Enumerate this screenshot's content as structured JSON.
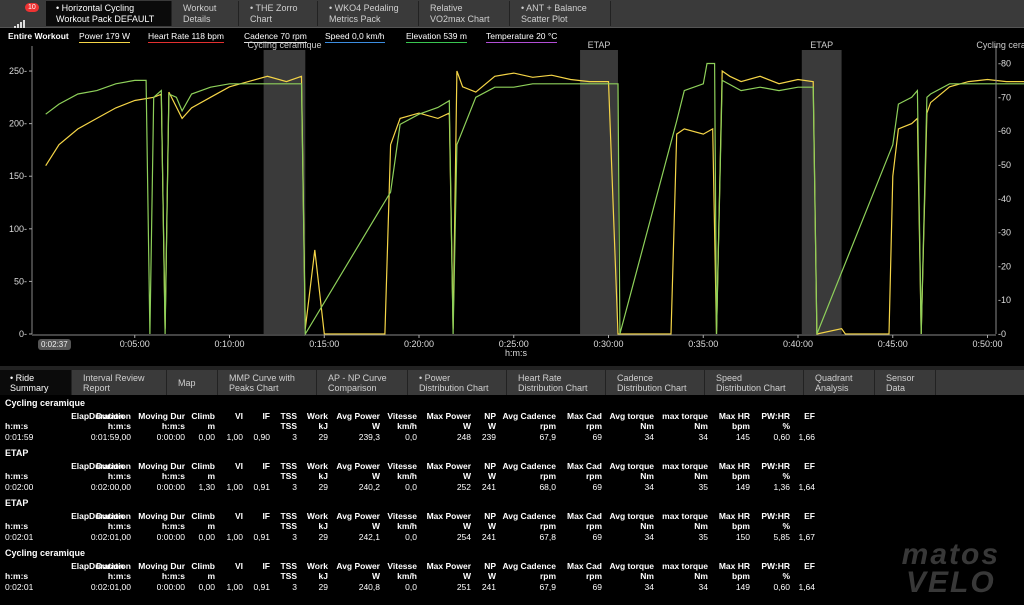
{
  "top_tabs": [
    {
      "label": "• Horizontal Cycling\nWorkout Pack DEFAULT"
    },
    {
      "label": "Workout\nDetails"
    },
    {
      "label": "• THE Zorro\nChart"
    },
    {
      "label": "• WKO4 Pedaling\nMetrics Pack"
    },
    {
      "label": "Relative\nVO2max Chart"
    },
    {
      "label": "• ANT + Balance\nScatter Plot"
    }
  ],
  "notification_badge": "10",
  "chart": {
    "scope_label": "Entire Workout",
    "legend": [
      {
        "label": "Power  179 W",
        "color": "#f5d547"
      },
      {
        "label": "Heart Rate  118 bpm",
        "color": "#e33030"
      },
      {
        "label": "Cadence  70 rpm",
        "color": "#dddddd"
      },
      {
        "label": "Speed  0,0 km/h",
        "color": "#3c8de0"
      },
      {
        "label": "Elevation  539 m",
        "color": "#39c650"
      },
      {
        "label": "Temperature  20 °C",
        "color": "#b24ed6"
      }
    ],
    "interval_labels": [
      "Cycling ceramique",
      "ETAP",
      "ETAP",
      "Cycling ceramique"
    ],
    "x_axis_label": "h:m:s",
    "current_time": "0:02:37"
  },
  "chart_data": {
    "type": "line",
    "x_ticks": [
      "0:05:00",
      "0:10:00",
      "0:15:00",
      "0:20:00",
      "0:25:00",
      "0:30:00",
      "0:35:00",
      "0:40:00",
      "0:45:00",
      "0:50:00"
    ],
    "y_left_ticks": [
      0,
      50,
      100,
      150,
      200,
      250
    ],
    "y_right_ticks": [
      0,
      10,
      20,
      30,
      40,
      50,
      60,
      70,
      80
    ],
    "xlabel": "h:m:s",
    "xlim_minutes": [
      0,
      53
    ],
    "ylim_left": [
      0,
      270
    ],
    "ylim_right": [
      0,
      84
    ],
    "intervals_minutes": [
      [
        11.8,
        14.0
      ],
      [
        28.5,
        30.5
      ],
      [
        40.2,
        42.3
      ],
      [
        52.5,
        54.6
      ]
    ],
    "series": [
      {
        "name": "Power",
        "color": "#f5d547",
        "axis": "left",
        "points": [
          [
            0.3,
            160
          ],
          [
            1,
            180
          ],
          [
            2,
            195
          ],
          [
            3,
            205
          ],
          [
            4,
            215
          ],
          [
            5,
            222
          ],
          [
            6,
            225
          ],
          [
            6.4,
            228
          ],
          [
            6.6,
            5
          ],
          [
            6.8,
            230
          ],
          [
            7.5,
            205
          ],
          [
            8,
            215
          ],
          [
            9,
            225
          ],
          [
            10,
            235
          ],
          [
            11,
            240
          ],
          [
            12,
            245
          ],
          [
            13,
            240
          ],
          [
            13.8,
            245
          ],
          [
            14,
            5
          ],
          [
            14.5,
            80
          ],
          [
            15,
            0
          ],
          [
            16,
            0
          ],
          [
            18.2,
            0
          ],
          [
            18.5,
            180
          ],
          [
            19,
            205
          ],
          [
            20,
            210
          ],
          [
            21,
            205
          ],
          [
            21.6,
            210
          ],
          [
            21.8,
            5
          ],
          [
            22,
            250
          ],
          [
            22.3,
            235
          ],
          [
            23,
            230
          ],
          [
            24,
            245
          ],
          [
            25,
            248
          ],
          [
            26,
            244
          ],
          [
            27,
            246
          ],
          [
            28,
            242
          ],
          [
            29,
            240
          ],
          [
            30,
            240
          ],
          [
            30.5,
            0
          ],
          [
            31,
            0
          ],
          [
            33.3,
            0
          ],
          [
            33.6,
            190
          ],
          [
            34,
            195
          ],
          [
            35,
            190
          ],
          [
            35.5,
            195
          ],
          [
            35.7,
            0
          ],
          [
            36,
            250
          ],
          [
            36.4,
            245
          ],
          [
            37,
            240
          ],
          [
            38,
            245
          ],
          [
            39,
            238
          ],
          [
            40,
            242
          ],
          [
            40.8,
            240
          ],
          [
            41,
            0
          ],
          [
            42.3,
            5
          ],
          [
            42.5,
            0
          ],
          [
            44.8,
            0
          ],
          [
            45,
            150
          ],
          [
            45.3,
            195
          ],
          [
            46,
            200
          ],
          [
            46.3,
            205
          ],
          [
            46.5,
            0
          ],
          [
            46.8,
            210
          ],
          [
            47,
            220
          ],
          [
            48,
            235
          ],
          [
            49,
            240
          ],
          [
            50,
            242
          ],
          [
            51,
            240
          ],
          [
            52,
            240
          ],
          [
            52.8,
            238
          ],
          [
            53,
            195
          ]
        ]
      },
      {
        "name": "Elevation",
        "color": "#8ed05a",
        "axis": "right",
        "points": [
          [
            0.3,
            65
          ],
          [
            1,
            68
          ],
          [
            2,
            71
          ],
          [
            3,
            72
          ],
          [
            4,
            74
          ],
          [
            5,
            75
          ],
          [
            5.6,
            75
          ],
          [
            5.8,
            0
          ],
          [
            6,
            70
          ],
          [
            6.4,
            72
          ],
          [
            6.6,
            0
          ],
          [
            6.8,
            71
          ],
          [
            7.2,
            70
          ],
          [
            7.5,
            66
          ],
          [
            8,
            71
          ],
          [
            9,
            73
          ],
          [
            10,
            74
          ],
          [
            11,
            74
          ],
          [
            12,
            74
          ],
          [
            13.8,
            74
          ],
          [
            14,
            0
          ],
          [
            18.5,
            42
          ],
          [
            19,
            62
          ],
          [
            20,
            65
          ],
          [
            21,
            67
          ],
          [
            21.6,
            69
          ],
          [
            21.8,
            0
          ],
          [
            22,
            56
          ],
          [
            23,
            70
          ],
          [
            24,
            73
          ],
          [
            25,
            73
          ],
          [
            26,
            74
          ],
          [
            27,
            74
          ],
          [
            28,
            74
          ],
          [
            29,
            74
          ],
          [
            30.5,
            74
          ],
          [
            30.6,
            0
          ],
          [
            33.6,
            63
          ],
          [
            34,
            72
          ],
          [
            35,
            74
          ],
          [
            35.2,
            80
          ],
          [
            35.6,
            80
          ],
          [
            35.7,
            0
          ],
          [
            36,
            75
          ],
          [
            37,
            72
          ],
          [
            38,
            73
          ],
          [
            39,
            72
          ],
          [
            40,
            73
          ],
          [
            40.8,
            73
          ],
          [
            41,
            0
          ],
          [
            45,
            56
          ],
          [
            45.3,
            68
          ],
          [
            46,
            70
          ],
          [
            46.3,
            72
          ],
          [
            46.5,
            0
          ],
          [
            46.8,
            70
          ],
          [
            47,
            71
          ],
          [
            48,
            74
          ],
          [
            49,
            74
          ],
          [
            50,
            74
          ],
          [
            51,
            74
          ],
          [
            52,
            74
          ],
          [
            52.8,
            75
          ],
          [
            53,
            85
          ]
        ]
      }
    ]
  },
  "bottom_tabs": [
    {
      "label": "• Ride\nSummary"
    },
    {
      "label": "Interval Review\nReport"
    },
    {
      "label": "Map"
    },
    {
      "label": "MMP Curve with\nPeaks Chart"
    },
    {
      "label": "AP - NP Curve\nComparison"
    },
    {
      "label": "• Power\nDistribution Chart"
    },
    {
      "label": "Heart Rate\nDistribution Chart"
    },
    {
      "label": "Cadence\nDistribution Chart"
    },
    {
      "label": "Speed\nDistribution Chart"
    },
    {
      "label": "Quadrant\nAnalysis"
    },
    {
      "label": "Sensor\nData"
    }
  ],
  "summary": {
    "columns": [
      {
        "name": "ElapDuration",
        "unit": "h:m:s"
      },
      {
        "name": "Duration",
        "unit": "h:m:s"
      },
      {
        "name": "Moving Dur",
        "unit": "h:m:s"
      },
      {
        "name": "Climb",
        "unit": "m"
      },
      {
        "name": "VI",
        "unit": ""
      },
      {
        "name": "IF",
        "unit": ""
      },
      {
        "name": "TSS",
        "unit": "TSS"
      },
      {
        "name": "Work",
        "unit": "kJ"
      },
      {
        "name": "Avg Power",
        "unit": "W"
      },
      {
        "name": "Vitesse",
        "unit": "km/h"
      },
      {
        "name": "Max Power",
        "unit": "W"
      },
      {
        "name": "NP",
        "unit": "W"
      },
      {
        "name": "Avg Cadence",
        "unit": "rpm"
      },
      {
        "name": "Max Cad",
        "unit": "rpm"
      },
      {
        "name": "Avg torque",
        "unit": "Nm"
      },
      {
        "name": "max torque",
        "unit": "Nm"
      },
      {
        "name": "Max HR",
        "unit": "bpm"
      },
      {
        "name": "PW:HR",
        "unit": "%"
      },
      {
        "name": "EF",
        "unit": ""
      }
    ],
    "blocks": [
      {
        "title": "Cycling ceramique",
        "values": [
          "0:01:59",
          "0:01:59,00",
          "0:00:00",
          "0,00",
          "1,00",
          "0,90",
          "3",
          "29",
          "239,3",
          "0,0",
          "248",
          "239",
          "67,9",
          "69",
          "34",
          "34",
          "145",
          "0,60",
          "1,66"
        ]
      },
      {
        "title": "ETAP",
        "values": [
          "0:02:00",
          "0:02:00,00",
          "0:00:00",
          "1,30",
          "1,00",
          "0,91",
          "3",
          "29",
          "240,2",
          "0,0",
          "252",
          "241",
          "68,0",
          "69",
          "34",
          "35",
          "149",
          "1,36",
          "1,64"
        ]
      },
      {
        "title": "ETAP",
        "values": [
          "0:02:01",
          "0:02:01,00",
          "0:00:00",
          "0,00",
          "1,00",
          "0,91",
          "3",
          "29",
          "242,1",
          "0,0",
          "254",
          "241",
          "67,8",
          "69",
          "34",
          "35",
          "150",
          "5,85",
          "1,67"
        ]
      },
      {
        "title": "Cycling ceramique",
        "values": [
          "0:02:01",
          "0:02:01,00",
          "0:00:00",
          "0,00",
          "1,00",
          "0,91",
          "3",
          "29",
          "240,8",
          "0,0",
          "251",
          "241",
          "67,9",
          "69",
          "34",
          "34",
          "149",
          "0,60",
          "1,64"
        ]
      }
    ]
  },
  "watermark": {
    "line1": "matos",
    "line2": "VELO"
  }
}
